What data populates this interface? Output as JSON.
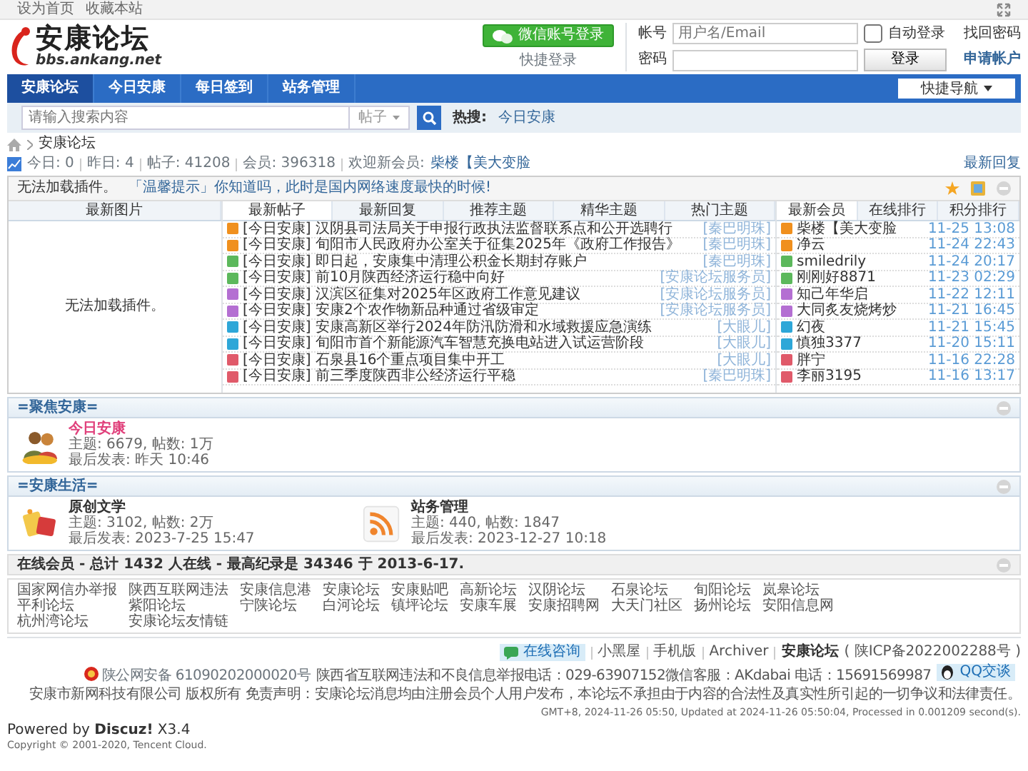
{
  "top_bar": {
    "links": [
      "设为首页",
      "收藏本站"
    ]
  },
  "logo": {
    "name": "安康论坛",
    "domain": "bbs.ankang.net"
  },
  "wechat_login": {
    "button": "微信账号登录",
    "caption": "快捷登录"
  },
  "login": {
    "username_label": "帐号",
    "username_placeholder": "用户名/Email",
    "auto_login": {
      "label": "自动登录",
      "checked": false
    },
    "password_label": "密码",
    "submit": "登录",
    "find_password": "找回密码",
    "register": "申请帐户"
  },
  "nav": {
    "items": [
      {
        "label": "安康论坛",
        "selected": true
      },
      {
        "label": "今日安康",
        "selected": false
      },
      {
        "label": "每日签到",
        "selected": false
      },
      {
        "label": "站务管理",
        "selected": false
      }
    ],
    "quick_nav": "快捷导航"
  },
  "search": {
    "placeholder": "请输入搜索内容",
    "scope": "帖子",
    "hot_label": "热搜:",
    "hot": [
      "今日安康"
    ]
  },
  "breadcrumb": [
    "安康论坛"
  ],
  "stats": {
    "parts": [
      "今日: 0",
      "昨日: 4",
      "帖子: 41208",
      "会员: 396318"
    ],
    "welcome": "欢迎新会员:",
    "new_member": "柴楼【美大变脸",
    "latest_reply": "最新回复"
  },
  "portal": {
    "title": "无法加载插件。",
    "notice": "「温馨提示」你知道吗，此时是国内网络速度最快的时候!",
    "image_tab": "最新图片",
    "image_placeholder": "无法加载插件。",
    "post_tabs": [
      {
        "label": "最新帖子",
        "selected": true
      },
      {
        "label": "最新回复",
        "selected": false
      },
      {
        "label": "推荐主题",
        "selected": false
      },
      {
        "label": "精华主题",
        "selected": false
      },
      {
        "label": "热门主题",
        "selected": false
      }
    ],
    "posts": [
      {
        "title": "[今日安康] 汉阴县司法局关于申报行政执法监督联系点和公开选聘行",
        "author": "[秦巴明珠]",
        "color": "#f0901e"
      },
      {
        "title": "[今日安康] 旬阳市人民政府办公室关于征集2025年《政府工作报告》",
        "author": "[秦巴明珠]",
        "color": "#f0901e"
      },
      {
        "title": "[今日安康] 即日起，安康集中清理公积金长期封存账户",
        "author": "[秦巴明珠]",
        "color": "#5cb85c"
      },
      {
        "title": "[今日安康] 前10月陕西经济运行稳中向好",
        "author": "[安康论坛服务员]",
        "color": "#5cb85c"
      },
      {
        "title": "[今日安康] 汉滨区征集对2025年区政府工作意见建议",
        "author": "[安康论坛服务员]",
        "color": "#b46fd2"
      },
      {
        "title": "[今日安康] 安康2个农作物新品种通过省级审定",
        "author": "[安康论坛服务员]",
        "color": "#b46fd2"
      },
      {
        "title": "[今日安康] 安康高新区举行2024年防汛防滑和水域救援应急演练",
        "author": "[大眼儿]",
        "color": "#2ea7d8"
      },
      {
        "title": "[今日安康] 旬阳市首个新能源汽车智慧充换电站进入试运营阶段",
        "author": "[大眼儿]",
        "color": "#2ea7d8"
      },
      {
        "title": "[今日安康] 石泉县16个重点项目集中开工",
        "author": "[大眼儿]",
        "color": "#e05a6a"
      },
      {
        "title": "[今日安康] 前三季度陕西非公经济运行平稳",
        "author": "[秦巴明珠]",
        "color": "#e05a6a"
      }
    ],
    "member_tabs": [
      {
        "label": "最新会员",
        "selected": true
      },
      {
        "label": "在线排行",
        "selected": false
      },
      {
        "label": "积分排行",
        "selected": false
      }
    ],
    "members": [
      {
        "name": "柴楼【美大变脸",
        "time": "11-25 13:08",
        "color": "#f0901e"
      },
      {
        "name": "净云",
        "time": "11-24 22:43",
        "color": "#f0901e"
      },
      {
        "name": "smiledrily",
        "time": "11-24 20:17",
        "color": "#5cb85c"
      },
      {
        "name": "刚刚好8871",
        "time": "11-23 02:29",
        "color": "#5cb85c"
      },
      {
        "name": "知己年华启",
        "time": "11-22 12:11",
        "color": "#b46fd2"
      },
      {
        "name": "大同炙友烧烤炒",
        "time": "11-21 16:45",
        "color": "#b46fd2"
      },
      {
        "name": "幻夜",
        "time": "11-21 15:45",
        "color": "#2ea7d8"
      },
      {
        "name": "慎独3377",
        "time": "11-20 15:11",
        "color": "#2ea7d8"
      },
      {
        "name": "胖宁",
        "time": "11-16 22:28",
        "color": "#e05a6a"
      },
      {
        "name": "李丽3195",
        "time": "11-16 13:17",
        "color": "#e05a6a"
      }
    ]
  },
  "categories": [
    {
      "title": "=聚焦安康=",
      "forums": [
        {
          "name": "今日安康",
          "kind": "people",
          "color": "#e0407b",
          "stats": "主题: 6679, 帖数: 1万",
          "last": "最后发表: 昨天 10:46"
        }
      ]
    },
    {
      "title": "=安康生活=",
      "forums": [
        {
          "name": "原创文学",
          "kind": "crafts",
          "color": "#333333",
          "stats": "主题: 3102, 帖数: 2万",
          "last": "最后发表: 2023-7-25 15:47"
        },
        {
          "name": "站务管理",
          "kind": "rss",
          "color": "#333333",
          "stats": "主题: 440, 帖数: 1847",
          "last": "最后发表: 2023-12-27 10:18"
        }
      ]
    }
  ],
  "online": "在线会员 - 总计 1432 人在线 - 最高纪录是 34346 于 2013-6-17.",
  "links": [
    "国家网信办举报",
    "陕西互联网违法",
    "安康信息港",
    "安康论坛",
    "安康贴吧",
    "高新论坛",
    "汉阴论坛",
    "石泉论坛",
    "旬阳论坛",
    "岚皋论坛",
    "平利论坛",
    "紫阳论坛",
    "宁陕论坛",
    "白河论坛",
    "镇坪论坛",
    "安康车展",
    "安康招聘网",
    "大天门社区",
    "扬州论坛",
    "安阳信息网",
    "杭州湾论坛",
    "安康论坛友情链"
  ],
  "footer": {
    "consult": "在线咨询",
    "links": [
      "小黑屋",
      "手机版",
      "Archiver"
    ],
    "site": "安康论坛",
    "icp": "( 陕ICP备2022002288号 )",
    "police": "陕公网安备 61090202000020号",
    "report": "陕西省互联网违法和不良信息举报电话：029-63907152微信客服：AKdabai 电话：15691569987",
    "qq": "QQ交谈",
    "company": "安康市新网科技有限公司 版权所有",
    "disclaimer": "免责声明：安康论坛消息均由注册会员个人用户发布，本论坛不承担由于内容的合法性及真实性所引起的一切争议和法律责任。",
    "gmt": "GMT+8, 2024-11-26 05:50, Updated at 2024-11-26 05:50:04, Processed in 0.001209 second(s).",
    "powered": "Powered by **Discuz!** X3.4",
    "copyright": "Copyright © 2001-2020, Tencent Cloud."
  }
}
